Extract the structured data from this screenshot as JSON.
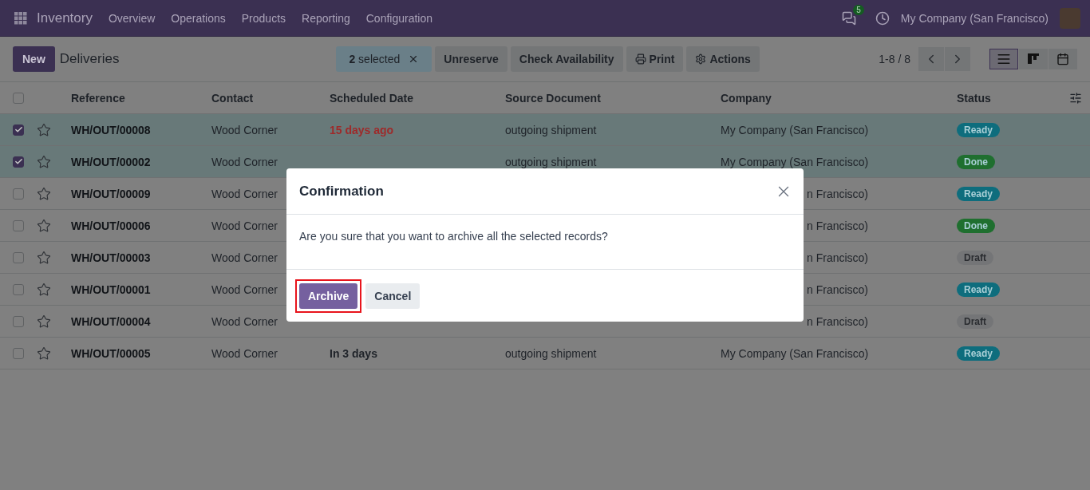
{
  "navbar": {
    "app": "Inventory",
    "menus": [
      "Overview",
      "Operations",
      "Products",
      "Reporting",
      "Configuration"
    ],
    "message_count": "5",
    "company": "My Company (San Francisco)"
  },
  "control_panel": {
    "new_button": "New",
    "title": "Deliveries",
    "selection": "**2** selected",
    "actions": [
      {
        "kind": "plain",
        "label": "Unreserve"
      },
      {
        "kind": "plain",
        "label": "Check Availability"
      },
      {
        "kind": "print",
        "label": "Print"
      },
      {
        "kind": "gear",
        "label": "Actions"
      }
    ],
    "pager": "1-8 / 8",
    "views": [
      {
        "kind": "list",
        "selected": true
      },
      {
        "kind": "kanban",
        "selected": false
      },
      {
        "kind": "calendar",
        "selected": false
      }
    ]
  },
  "table": {
    "all_selected": false,
    "columns": [
      "Reference",
      "Contact",
      "Scheduled Date",
      "Source Document",
      "Company",
      "Status"
    ],
    "rows": [
      {
        "selected": true,
        "covered": false,
        "reference": "WH/OUT/00008",
        "contact": "Wood Corner",
        "scheduled_date": {
          "text": "15 days ago",
          "color": "#9e2a2a"
        },
        "source_document": "outgoing shipment",
        "company": "My Company (San Francisco)",
        "status": {
          "label": "Ready",
          "color": "#0e6d7d"
        }
      },
      {
        "selected": true,
        "covered": false,
        "reference": "WH/OUT/00002",
        "contact": "Wood Corner",
        "source_document": "outgoing shipment",
        "company": "My Company (San Francisco)",
        "status": {
          "label": "Done",
          "color": "#1f6f2f"
        }
      },
      {
        "selected": false,
        "covered": true,
        "reference": "WH/OUT/00009",
        "contact": "Wood Corner",
        "company": "n Francisco)",
        "status": {
          "label": "Ready",
          "color": "#0e6d7d"
        }
      },
      {
        "selected": false,
        "covered": true,
        "reference": "WH/OUT/00006",
        "contact": "Wood Corner",
        "company": "n Francisco)",
        "status": {
          "label": "Done",
          "color": "#1f6f2f"
        }
      },
      {
        "selected": false,
        "covered": true,
        "reference": "WH/OUT/00003",
        "contact": "Wood Corner",
        "company": "n Francisco)",
        "status": {
          "label": "Draft",
          "color": "#747577"
        }
      },
      {
        "selected": false,
        "covered": true,
        "reference": "WH/OUT/00001",
        "contact": "Wood Corner",
        "company": "n Francisco)",
        "status": {
          "label": "Ready",
          "color": "#0e6d7d"
        }
      },
      {
        "selected": false,
        "covered": true,
        "reference": "WH/OUT/00004",
        "contact": "Wood Corner",
        "company": "n Francisco)",
        "status": {
          "label": "Draft",
          "color": "#747577"
        }
      },
      {
        "selected": false,
        "covered": false,
        "reference": "WH/OUT/00005",
        "contact": "Wood Corner",
        "scheduled_date": {
          "text": "In 3 days",
          "color": "#1e2228"
        },
        "source_document": "outgoing shipment",
        "company": "My Company (San Francisco)",
        "status": {
          "label": "Ready",
          "color": "#0e6d7d"
        }
      }
    ]
  },
  "dialog": {
    "title": "Confirmation",
    "message": "Are you sure that you want to archive all the selected records?",
    "buttons": [
      {
        "kind": "primary",
        "label": "Archive",
        "highlighted": true
      },
      {
        "kind": "secondary",
        "label": "Cancel",
        "highlighted": false
      }
    ]
  }
}
